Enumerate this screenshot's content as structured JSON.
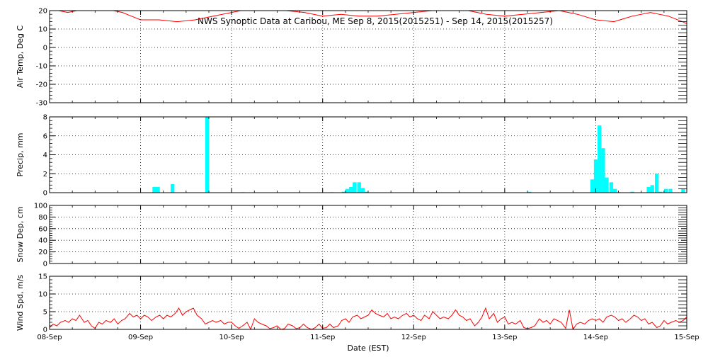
{
  "chart_data": {
    "title": "NWS Synoptic Data at Caribou, ME   Sep  8, 2015(2015251) - Sep 14, 2015(2015257)",
    "xlabel": "Date (EST)",
    "x_tick_labels": [
      "08-Sep",
      "09-Sep",
      "10-Sep",
      "11-Sep",
      "12-Sep",
      "13-Sep",
      "14-Sep",
      "15-Sep"
    ],
    "x_range_days": [
      0,
      7
    ],
    "colors": {
      "bar": "#00ffff",
      "line": "#ff0000",
      "axis": "#000000"
    },
    "panels": [
      {
        "id": "air-temp",
        "type": "line",
        "ylabel": "Air Temp, Deg C",
        "ylim": [
          -30,
          20
        ],
        "ytick_labels": [
          "-30",
          "-20",
          "-10",
          "0",
          "10",
          "20"
        ],
        "grid": true,
        "series": [
          {
            "x": [
              0,
              0.1,
              0.2,
              0.3,
              0.5,
              0.7,
              0.8,
              0.9,
              1.0,
              1.2,
              1.4,
              1.6,
              1.8,
              2.0,
              2.2,
              2.4,
              2.6,
              2.8,
              3.0,
              3.2,
              3.4,
              3.6,
              3.8,
              4.0,
              4.2,
              4.4,
              4.6,
              4.8,
              5.0,
              5.2,
              5.4,
              5.6,
              5.8,
              6.0,
              6.2,
              6.4,
              6.6,
              6.8,
              7.0
            ],
            "y": [
              20,
              20,
              19,
              20,
              21,
              20,
              19,
              17,
              15,
              15,
              14,
              15,
              17,
              19,
              21,
              21,
              20,
              19,
              17,
              18,
              17,
              17,
              18,
              19,
              20,
              21,
              20,
              18,
              17,
              18,
              19,
              20,
              18,
              15,
              14,
              17,
              19,
              17,
              13
            ]
          }
        ]
      },
      {
        "id": "precip",
        "type": "bar",
        "ylabel": "Precip, mm",
        "ylim": [
          0,
          8
        ],
        "ytick_labels": [
          "0",
          "2",
          "4",
          "6",
          "8"
        ],
        "grid": true,
        "bar_width_days": 0.0417,
        "bars": {
          "x": [
            1.13,
            1.17,
            1.33,
            1.71,
            2.1,
            3.08,
            3.21,
            3.25,
            3.29,
            3.33,
            3.38,
            3.42,
            3.46,
            4.96,
            5.25,
            5.94,
            5.98,
            6.02,
            6.06,
            6.1,
            6.15,
            6.19,
            6.23,
            6.38,
            6.56,
            6.6,
            6.65,
            6.69,
            6.75,
            6.8,
            6.94
          ],
          "values": [
            0.6,
            0.6,
            0.9,
            8.0,
            0.05,
            0.05,
            0.1,
            0.4,
            0.6,
            1.1,
            1.1,
            0.5,
            0.1,
            0.05,
            0.1,
            1.4,
            3.5,
            7.1,
            4.7,
            1.6,
            1.1,
            0.4,
            0.05,
            0.1,
            0.6,
            0.8,
            2.0,
            0.1,
            0.4,
            0.4,
            0.4
          ]
        }
      },
      {
        "id": "snow-depth",
        "type": "line",
        "ylabel": "Snow Dep, cm",
        "ylim": [
          0,
          100
        ],
        "ytick_labels": [
          "0",
          "20",
          "40",
          "60",
          "80",
          "100"
        ],
        "grid": true,
        "series": []
      },
      {
        "id": "wind-speed",
        "type": "line",
        "ylabel": "Wind Spd, m/s",
        "ylim": [
          0,
          15
        ],
        "ytick_labels": [
          "0",
          "5",
          "10",
          "15"
        ],
        "grid": true,
        "series": [
          {
            "x": [
              0,
              0.04,
              0.08,
              0.12,
              0.17,
              0.21,
              0.25,
              0.29,
              0.33,
              0.38,
              0.42,
              0.46,
              0.5,
              0.54,
              0.58,
              0.62,
              0.67,
              0.71,
              0.75,
              0.79,
              0.83,
              0.88,
              0.92,
              0.96,
              1.0,
              1.04,
              1.08,
              1.12,
              1.17,
              1.21,
              1.25,
              1.29,
              1.33,
              1.38,
              1.42,
              1.46,
              1.5,
              1.54,
              1.58,
              1.62,
              1.67,
              1.71,
              1.75,
              1.79,
              1.83,
              1.88,
              1.92,
              1.96,
              2.0,
              2.04,
              2.08,
              2.12,
              2.17,
              2.21,
              2.25,
              2.29,
              2.33,
              2.38,
              2.42,
              2.46,
              2.5,
              2.54,
              2.58,
              2.62,
              2.67,
              2.71,
              2.75,
              2.79,
              2.83,
              2.88,
              2.92,
              2.96,
              3.0,
              3.04,
              3.08,
              3.12,
              3.17,
              3.21,
              3.25,
              3.29,
              3.33,
              3.38,
              3.42,
              3.46,
              3.5,
              3.54,
              3.58,
              3.62,
              3.67,
              3.71,
              3.75,
              3.79,
              3.83,
              3.88,
              3.92,
              3.96,
              4.0,
              4.04,
              4.08,
              4.12,
              4.17,
              4.21,
              4.25,
              4.29,
              4.33,
              4.38,
              4.42,
              4.46,
              4.5,
              4.54,
              4.58,
              4.62,
              4.67,
              4.71,
              4.75,
              4.79,
              4.83,
              4.88,
              4.92,
              4.96,
              5.0,
              5.04,
              5.08,
              5.12,
              5.17,
              5.21,
              5.25,
              5.29,
              5.33,
              5.38,
              5.42,
              5.46,
              5.5,
              5.54,
              5.58,
              5.62,
              5.67,
              5.71,
              5.75,
              5.79,
              5.83,
              5.88,
              5.92,
              5.96,
              6.0,
              6.04,
              6.08,
              6.12,
              6.17,
              6.21,
              6.25,
              6.29,
              6.33,
              6.38,
              6.42,
              6.46,
              6.5,
              6.54,
              6.58,
              6.62,
              6.67,
              6.71,
              6.75,
              6.79,
              6.83,
              6.88,
              6.92,
              6.96,
              7.0
            ],
            "y": [
              0.5,
              1.5,
              1.0,
              2.0,
              2.5,
              2.0,
              3.0,
              2.5,
              4.0,
              2.0,
              2.5,
              1.0,
              0.3,
              2.0,
              1.5,
              2.5,
              2.0,
              3.0,
              1.5,
              2.5,
              3.0,
              4.5,
              3.5,
              4.0,
              3.0,
              4.0,
              3.5,
              2.5,
              3.5,
              4.0,
              3.0,
              4.0,
              3.5,
              4.5,
              6.0,
              4.0,
              5.0,
              5.5,
              6.0,
              4.0,
              3.0,
              1.5,
              2.0,
              2.5,
              2.0,
              2.5,
              1.5,
              2.0,
              2.0,
              1.0,
              0.3,
              1.0,
              2.0,
              0.0,
              3.0,
              2.0,
              1.5,
              1.0,
              0.2,
              0.5,
              1.0,
              0.0,
              0.2,
              1.5,
              1.0,
              0.2,
              0.5,
              1.5,
              0.5,
              0.0,
              0.5,
              1.5,
              0.3,
              0.5,
              1.5,
              0.5,
              1.0,
              2.5,
              3.0,
              2.0,
              3.5,
              4.0,
              3.0,
              3.5,
              4.0,
              5.5,
              4.5,
              4.0,
              3.5,
              4.5,
              3.0,
              3.5,
              3.0,
              4.0,
              4.5,
              3.5,
              4.0,
              3.0,
              2.5,
              4.0,
              3.0,
              5.0,
              4.0,
              3.0,
              3.5,
              3.0,
              4.0,
              5.5,
              4.0,
              3.5,
              2.5,
              3.0,
              1.0,
              2.0,
              3.5,
              6.0,
              3.0,
              4.5,
              2.0,
              3.0,
              3.5,
              1.5,
              2.0,
              1.5,
              2.5,
              0.5,
              0.2,
              0.5,
              1.0,
              3.0,
              2.0,
              2.5,
              1.5,
              3.0,
              2.5,
              2.0,
              0.3,
              5.5,
              0.0,
              1.5,
              2.0,
              1.5,
              2.5,
              3.0,
              2.5,
              3.0,
              2.0,
              3.5,
              4.0,
              3.5,
              2.5,
              3.0,
              2.0,
              3.0,
              4.0,
              3.5,
              2.5,
              3.0,
              1.5,
              2.0,
              0.5,
              1.0,
              2.5,
              1.5,
              2.0,
              2.5,
              2.0,
              2.5,
              3.5,
              3.0,
              3.5,
              4.0,
              4.5,
              4.0,
              4.5,
              4.0
            ]
          }
        ]
      }
    ]
  }
}
